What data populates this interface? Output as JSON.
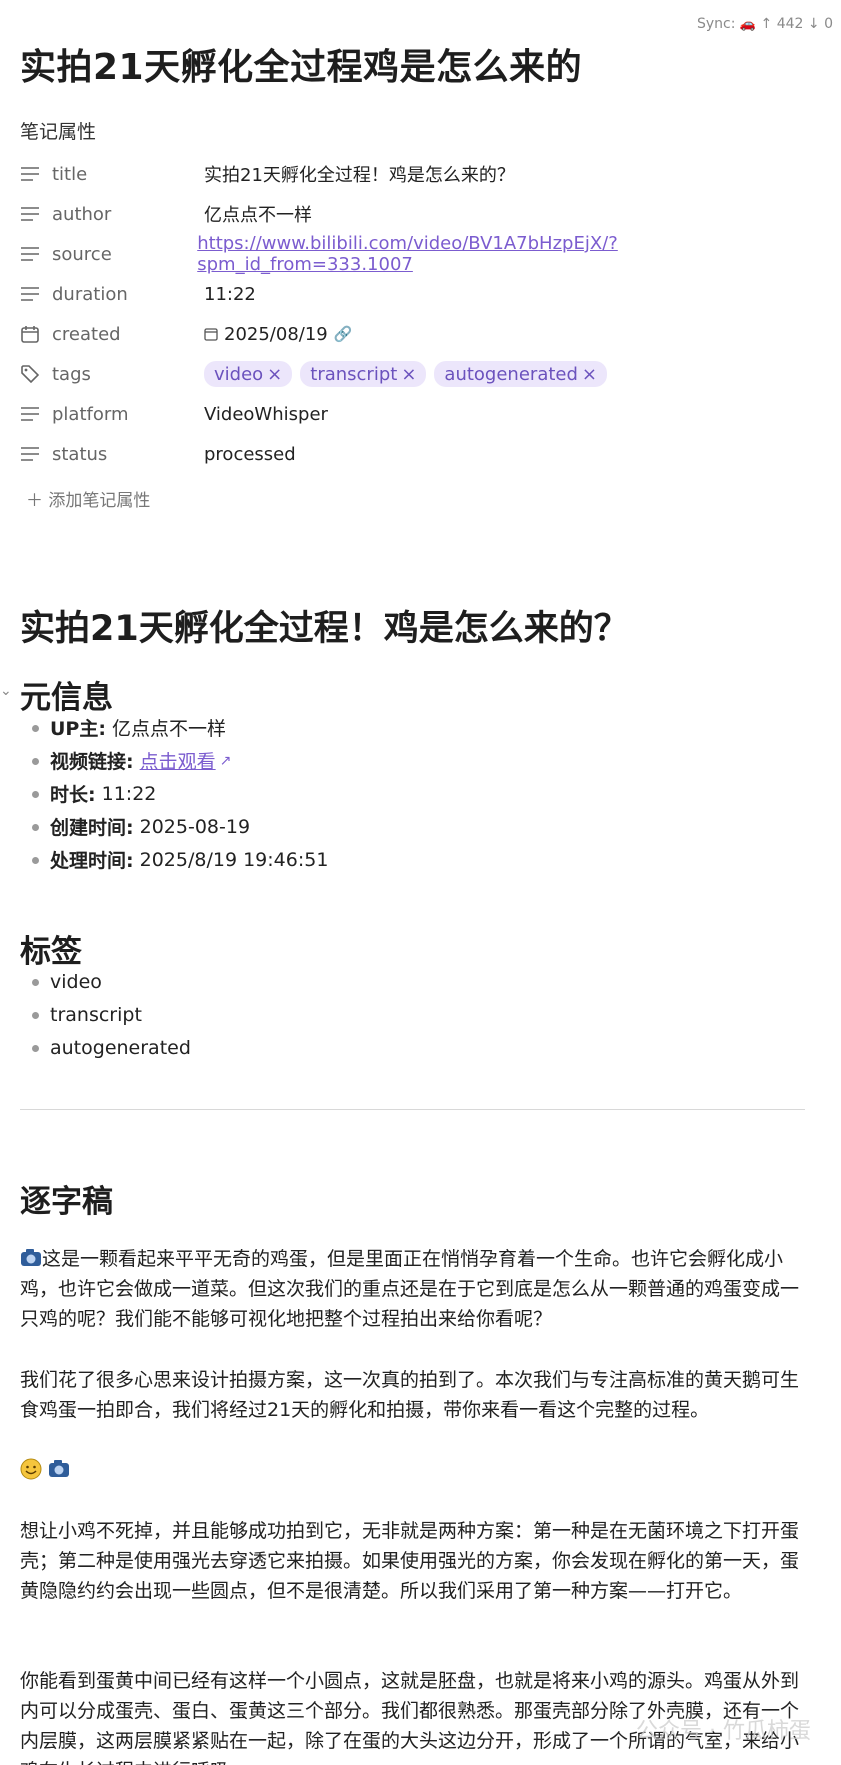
{
  "sync": {
    "label": "Sync:",
    "icon": "car-icon",
    "uploaded": "↑ 442",
    "pending": "↓ 0"
  },
  "doc": {
    "title": "实拍21天孵化全过程鸡是怎么来的"
  },
  "properties": {
    "heading": "笔记属性",
    "title": {
      "key": "title",
      "value": "实拍21天孵化全过程！鸡是怎么来的？"
    },
    "author": {
      "key": "author",
      "value": "亿点点不一样"
    },
    "source": {
      "key": "source",
      "value": "https://www.bilibili.com/video/BV1A7bHzpEjX/?spm_id_from=333.1007"
    },
    "duration": {
      "key": "duration",
      "value": "11:22"
    },
    "created": {
      "key": "created",
      "value": "2025/08/19"
    },
    "tags": {
      "key": "tags",
      "items": [
        "video",
        "transcript",
        "autogenerated"
      ],
      "remove_glyph": "×"
    },
    "platform": {
      "key": "platform",
      "value": "VideoWhisper"
    },
    "status": {
      "key": "status",
      "value": "processed"
    },
    "add_label": "添加笔记属性"
  },
  "content": {
    "h1": "实拍21天孵化全过程！鸡是怎么来的？",
    "meta_heading": "元信息",
    "meta": [
      {
        "label": "UP主:",
        "value": "亿点点不一样"
      },
      {
        "label": "视频链接:",
        "value": "点击观看"
      },
      {
        "label": "时长:",
        "value": "11:22"
      },
      {
        "label": "创建时间:",
        "value": "2025-08-19"
      },
      {
        "label": "处理时间:",
        "value": "2025/8/19 19:46:51"
      }
    ],
    "tags_heading": "标签",
    "tags": [
      "video",
      "transcript",
      "autogenerated"
    ],
    "transcript_heading": "逐字稿",
    "paragraphs": [
      "这是一颗看起来平平无奇的鸡蛋，但是里面正在悄悄孕育着一个生命。也许它会孵化成小鸡，也许它会做成一道菜。但这次我们的重点还是在于它到底是怎么从一颗普通的鸡蛋变成一只鸡的呢？我们能不能够可视化地把整个过程拍出来给你看呢？",
      "我们花了很多心思来设计拍摄方案，这一次真的拍到了。本次我们与专注高标准的黄天鹅可生食鸡蛋一拍即合，我们将经过21天的孵化和拍摄，带你来看一看这个完整的过程。",
      "想让小鸡不死掉，并且能够成功拍到它，无非就是两种方案：第一种是在无菌环境之下打开蛋壳；第二种是使用强光去穿透它来拍摄。如果使用强光的方案，你会发现在孵化的第一天，蛋黄隐隐约约会出现一些圆点，但不是很清楚。所以我们采用了第一种方案——打开它。",
      "你能看到蛋黄中间已经有这样一个小圆点，这就是胚盘，也就是将来小鸡的源头。鸡蛋从外到内可以分成蛋壳、蛋白、蛋黄这三个部分。我们都很熟悉。那蛋壳部分除了外壳膜，还有一个内层膜，这两层膜紧紧贴在一起，除了在蛋的大头这边分开，形成了一个所谓的气室，来给小鸡在生长过程中进行呼吸。"
    ]
  },
  "watermark": "公众号 · 竹瓜柿蛋"
}
